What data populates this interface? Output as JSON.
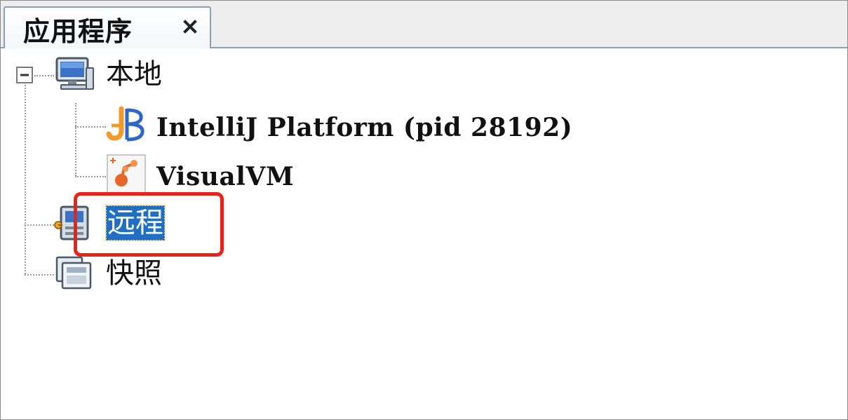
{
  "tab": {
    "title": "应用程序",
    "close_glyph": "×"
  },
  "tree": {
    "local": {
      "label": "本地",
      "icon": "computer-icon",
      "expanded": true,
      "children": [
        {
          "label": "IntelliJ Platform (pid 28192)",
          "icon": "intellij-icon"
        },
        {
          "label": "VisualVM",
          "icon": "visualvm-icon"
        }
      ]
    },
    "remote": {
      "label": "远程",
      "icon": "remote-host-icon",
      "selected": true
    },
    "snapshots": {
      "label": "快照",
      "icon": "snapshots-icon"
    }
  },
  "colors": {
    "selection": "#1f6fc5",
    "annotation": "#e8231a",
    "tab_border": "#8c9fb9"
  }
}
